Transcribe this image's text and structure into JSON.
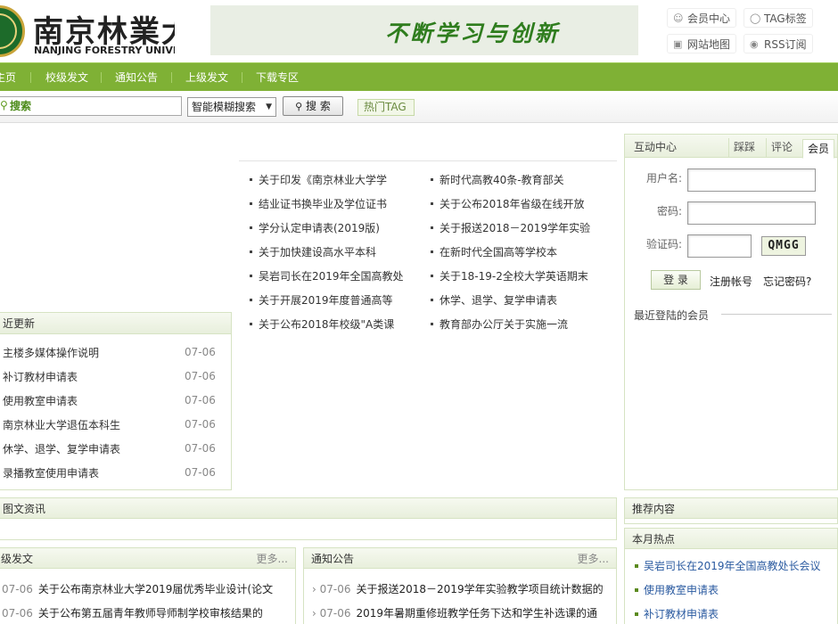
{
  "header": {
    "logo_cn": "南京林業大",
    "logo_en": "NANJING FORESTRY UNIVER",
    "slogan": "不断学习与创新",
    "links": [
      {
        "label": "会员中心",
        "icon": "user-icon"
      },
      {
        "label": "TAG标签",
        "icon": "tag-icon"
      },
      {
        "label": "网站地图",
        "icon": "map-icon"
      },
      {
        "label": "RSS订阅",
        "icon": "rss-icon"
      }
    ]
  },
  "nav": {
    "items": [
      "主页",
      "校级发文",
      "通知公告",
      "上级发文",
      "下载专区"
    ]
  },
  "search": {
    "placeholder": "搜索",
    "mode": "智能模糊搜索",
    "button": "搜 索",
    "hot_tag": "热门TAG"
  },
  "top_news": {
    "left": [
      "关于印发《南京林业大学学",
      "结业证书换毕业及学位证书",
      "学分认定申请表(2019版)",
      "关于加快建设高水平本科",
      "吴岩司长在2019年全国高教处",
      "关于开展2019年度普通高等",
      "关于公布2018年校级\"A类课"
    ],
    "right": [
      "新时代高教40条-教育部关",
      "关于公布2018年省级在线开放",
      "关于报送2018－2019学年实验",
      "在新时代全国高等学校本",
      "关于18-19-2全校大学英语期末",
      "休学、退学、复学申请表",
      "教育部办公厅关于实施一流"
    ]
  },
  "recent_updates": {
    "title": "近更新",
    "items": [
      {
        "title": "主楼多媒体操作说明",
        "date": "07-06"
      },
      {
        "title": "补订教材申请表",
        "date": "07-06"
      },
      {
        "title": "使用教室申请表",
        "date": "07-06"
      },
      {
        "title": "南京林业大学退伍本科生",
        "date": "07-06"
      },
      {
        "title": "休学、退学、复学申请表",
        "date": "07-06"
      },
      {
        "title": "录播教室使用申请表",
        "date": "07-06"
      }
    ]
  },
  "member": {
    "title": "互动中心",
    "tabs": [
      "踩踩",
      "评论",
      "会员"
    ],
    "username_label": "用户名:",
    "password_label": "密码:",
    "captcha_label": "验证码:",
    "captcha_code": "QMGG",
    "login": "登 录",
    "register": "注册帐号",
    "forgot": "忘记密码?",
    "recent_login": "最近登陆的会员"
  },
  "tuwen": {
    "title": "图文资讯"
  },
  "recommend": {
    "title": "推荐内容"
  },
  "hot_month": {
    "title": "本月热点",
    "items": [
      "吴岩司长在2019年全国高教处长会议",
      "使用教室申请表",
      "补订教材申请表"
    ]
  },
  "xiaoji": {
    "title": "级发文",
    "more": "更多...",
    "items": [
      {
        "date": "07-06",
        "title": "关于公布南京林业大学2019届优秀毕业设计(论文"
      },
      {
        "date": "07-06",
        "title": "关于公布第五届青年教师导师制学校审核结果的"
      }
    ]
  },
  "tongzhi": {
    "title": "通知公告",
    "more": "更多...",
    "items": [
      {
        "date": "07-06",
        "title": "关于报送2018－2019学年实验教学项目统计数据的"
      },
      {
        "date": "07-06",
        "title": "2019年暑期重修班教学任务下达和学生补选课的通"
      }
    ]
  },
  "colors": {
    "nav_green": "#7fb135",
    "accent_green": "#2f7d1e",
    "link_blue": "#2a5aa0"
  }
}
